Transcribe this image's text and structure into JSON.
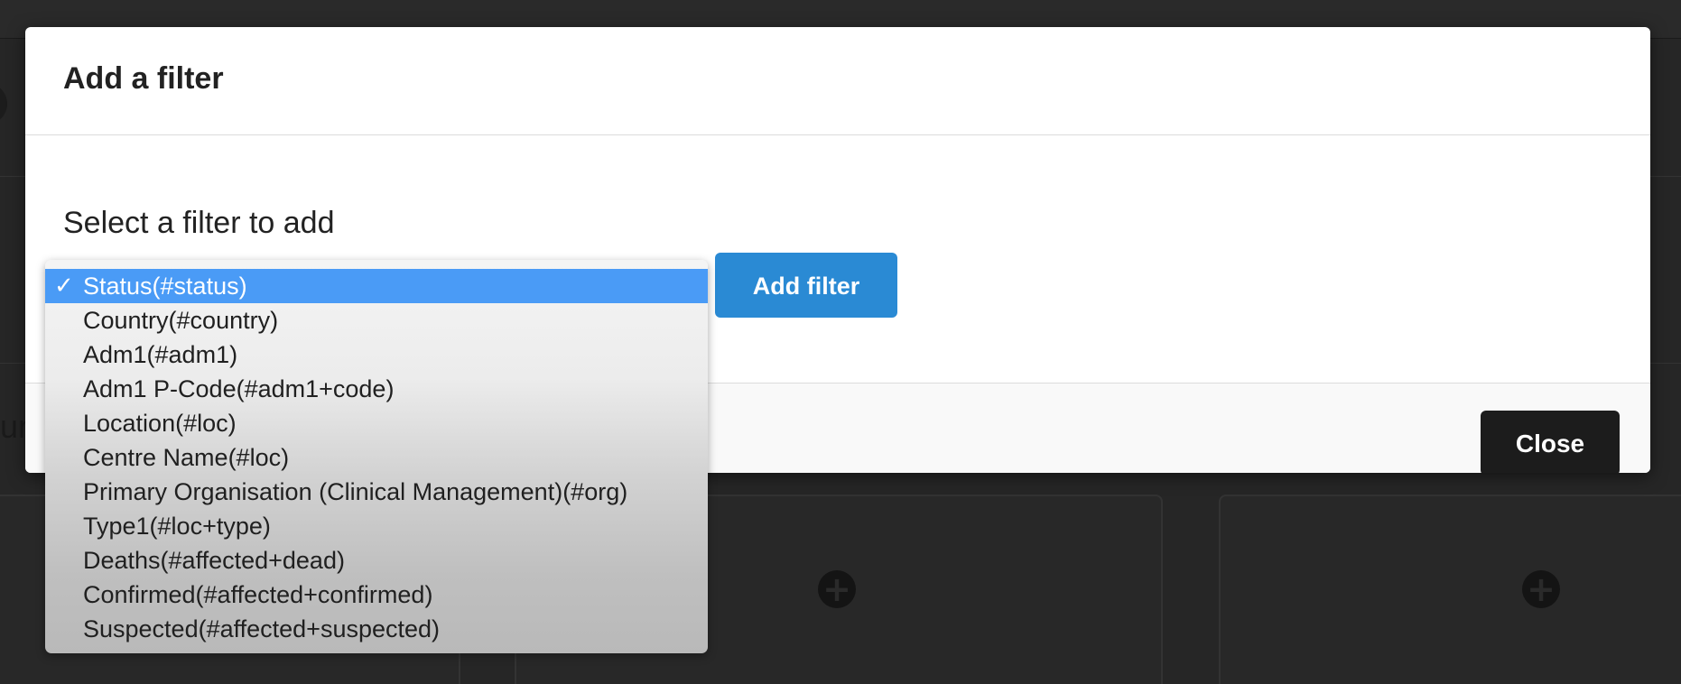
{
  "modal": {
    "title": "Add a filter",
    "body_label": "Select a filter to add",
    "add_button_label": "Add filter",
    "close_button_label": "Close"
  },
  "select": {
    "selected_index": 0,
    "check_glyph": "✓",
    "options": [
      "Status(#status)",
      "Country(#country)",
      "Adm1(#adm1)",
      "Adm1 P-Code(#adm1+code)",
      "Location(#loc)",
      "Centre Name(#loc)",
      "Primary Organisation (Clinical Management)(#org)",
      "Type1(#loc+type)",
      "Deaths(#affected+dead)",
      "Confirmed(#affected+confirmed)",
      "Suspected(#affected+suspected)"
    ]
  },
  "background": {
    "heading_fragment": "un",
    "card_icon": "plus-circle-icon"
  },
  "colors": {
    "primary_button": "#2a8ad4",
    "close_button": "#1c1c1c",
    "selected_option": "#4a9bf6",
    "backdrop": "#262626"
  }
}
